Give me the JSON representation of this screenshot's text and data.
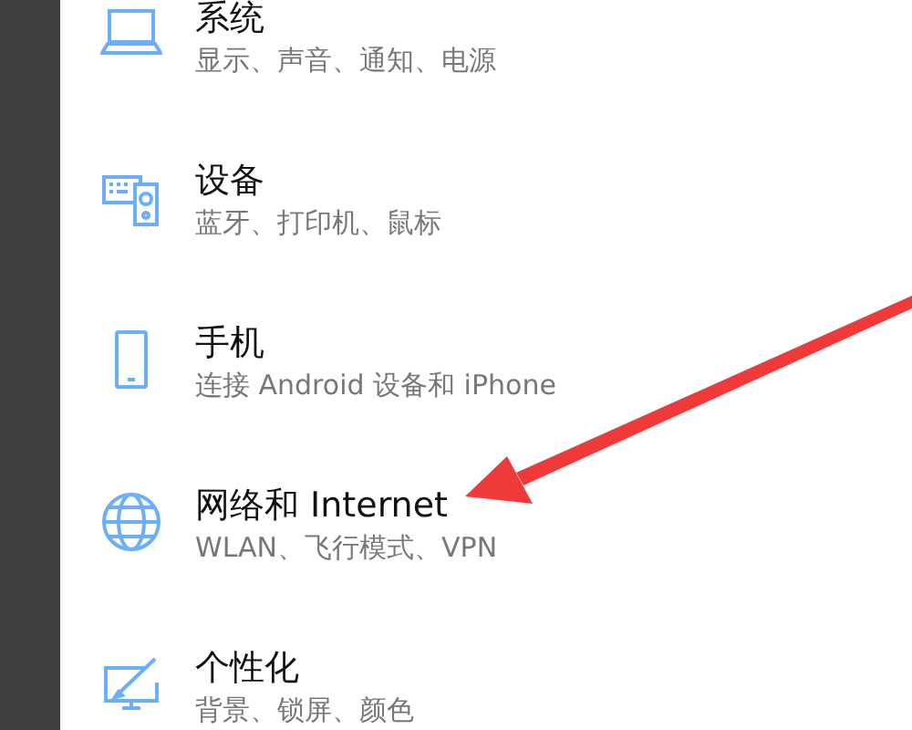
{
  "items": [
    {
      "kind": "laptop",
      "title": "系统",
      "subtitle": "显示、声音、通知、电源"
    },
    {
      "kind": "devices",
      "title": "设备",
      "subtitle": "蓝牙、打印机、鼠标"
    },
    {
      "kind": "phone",
      "title": "手机",
      "subtitle": "连接 Android 设备和 iPhone"
    },
    {
      "kind": "globe",
      "title": "网络和 Internet",
      "subtitle": "WLAN、飞行模式、VPN"
    },
    {
      "kind": "personalize",
      "title": "个性化",
      "subtitle": "背景、锁屏、颜色"
    }
  ],
  "annotation": {
    "kind": "arrow"
  }
}
